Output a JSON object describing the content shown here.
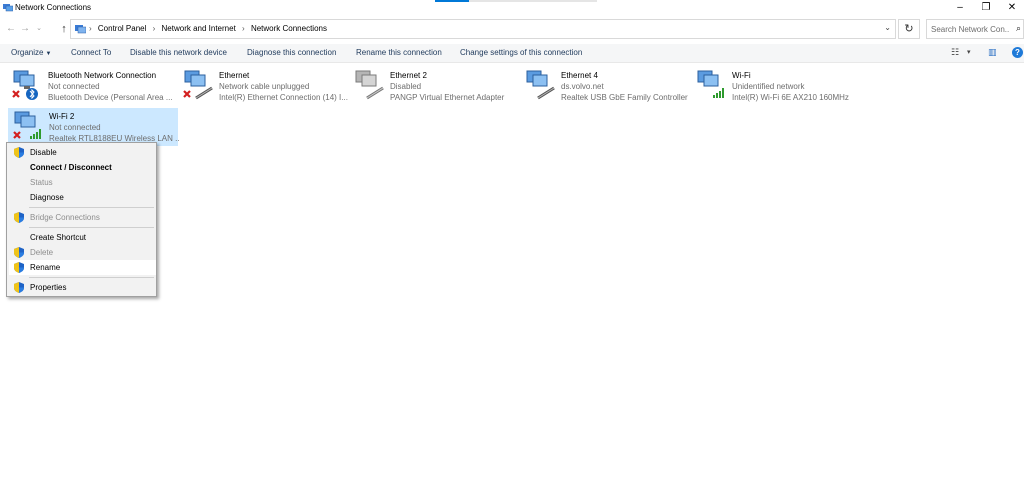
{
  "window": {
    "title": "Network Connections",
    "minimize_glyph": "–",
    "maximize_glyph": "❐",
    "close_glyph": "✕"
  },
  "address": {
    "back_glyph": "←",
    "forward_glyph": "→",
    "recent_glyph": "⌄",
    "up_glyph": "↑",
    "crumbs": [
      "Control Panel",
      "Network and Internet",
      "Network Connections"
    ],
    "separator": "›",
    "dropdown_glyph": "⌄",
    "refresh_glyph": "↻",
    "search_placeholder": "Search Network Con...",
    "search_icon": "⌕"
  },
  "commands": {
    "organize": "Organize",
    "organize_caret": "▼",
    "connect_to": "Connect To",
    "disable_device": "Disable this network device",
    "diagnose": "Diagnose this connection",
    "rename": "Rename this connection",
    "change_settings": "Change settings of this connection",
    "view_glyph": "☷",
    "view_caret": "▾",
    "pane_glyph": "▥",
    "help_glyph": "?"
  },
  "connections": [
    {
      "name": "Bluetooth Network Connection",
      "status": "Not connected",
      "device": "Bluetooth Device (Personal Area ...",
      "type": "bluetooth",
      "state_icon": "red-x"
    },
    {
      "name": "Ethernet",
      "status": "Network cable unplugged",
      "device": "Intel(R) Ethernet Connection (14) I...",
      "type": "ethernet",
      "state_icon": "red-x"
    },
    {
      "name": "Ethernet 2",
      "status": "Disabled",
      "device": "PANGP Virtual Ethernet Adapter",
      "type": "ethernet-disabled",
      "state_icon": "none"
    },
    {
      "name": "Ethernet 4",
      "status": "ds.volvo.net",
      "device": "Realtek USB GbE Family Controller",
      "type": "ethernet",
      "state_icon": "none"
    },
    {
      "name": "Wi-Fi",
      "status": "Unidentified network",
      "device": "Intel(R) Wi-Fi 6E AX210 160MHz",
      "type": "wifi",
      "state_icon": "signal"
    },
    {
      "name": "Wi-Fi 2",
      "status": "Not connected",
      "device": "Realtek RTL8188EU Wireless LAN ...",
      "type": "wifi",
      "state_icon": "red-x",
      "selected": true
    }
  ],
  "context_menu": {
    "items": [
      {
        "label": "Disable",
        "shield": true,
        "bold": false,
        "disabled": false
      },
      {
        "label": "Connect / Disconnect",
        "shield": false,
        "bold": true,
        "disabled": false
      },
      {
        "label": "Status",
        "shield": false,
        "bold": false,
        "disabled": true
      },
      {
        "label": "Diagnose",
        "shield": false,
        "bold": false,
        "disabled": false
      },
      {
        "label": "Bridge Connections",
        "shield": true,
        "bold": false,
        "disabled": true
      },
      {
        "label": "Create Shortcut",
        "shield": false,
        "bold": false,
        "disabled": false
      },
      {
        "label": "Delete",
        "shield": true,
        "bold": false,
        "disabled": true
      },
      {
        "label": "Rename",
        "shield": true,
        "bold": false,
        "disabled": false,
        "hover": true
      },
      {
        "label": "Properties",
        "shield": true,
        "bold": false,
        "disabled": false
      }
    ]
  },
  "colors": {
    "accent": "#0078d7",
    "selection": "#cce8ff",
    "command_text": "#1e395b",
    "secondary_text": "#6d6d6d",
    "error_red": "#d32020",
    "signal_green": "#2e9b2e",
    "bluetooth_blue": "#1565c0"
  }
}
